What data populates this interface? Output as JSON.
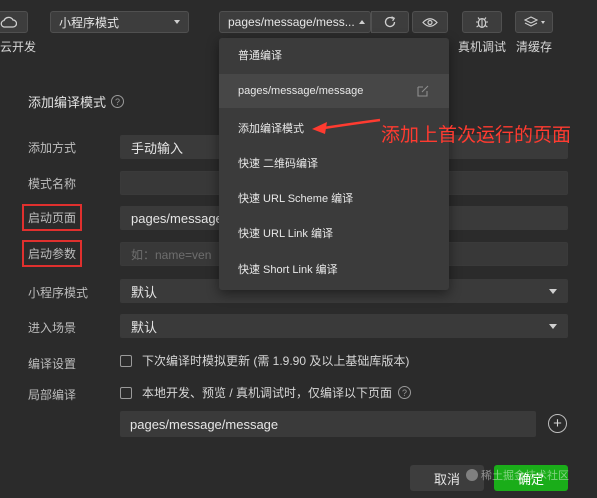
{
  "toolbar": {
    "left_label": "云开发",
    "mode_select": "小程序模式",
    "compile_select": "pages/message/mess...",
    "real_device_label": "真机调试",
    "clear_cache_label": "清缓存"
  },
  "dropdown": {
    "items": [
      {
        "label": "普通编译"
      },
      {
        "label": "pages/message/message"
      },
      {
        "label": "添加编译模式"
      },
      {
        "label": "快速 二维码编译"
      },
      {
        "label": "快速 URL Scheme 编译"
      },
      {
        "label": "快速 URL Link 编译"
      },
      {
        "label": "快速 Short Link 编译"
      }
    ]
  },
  "annotation": {
    "text": "添加上首次运行的页面",
    "color": "#ff3b30"
  },
  "form": {
    "title": "添加编译模式",
    "add_method": {
      "label": "添加方式",
      "value": "手动输入"
    },
    "mode_name": {
      "label": "模式名称",
      "value": ""
    },
    "start_page": {
      "label": "启动页面",
      "value": "pages/message"
    },
    "start_params": {
      "label": "启动参数",
      "placeholder": "如：name=ven"
    },
    "mini_mode": {
      "label": "小程序模式",
      "value": "默认"
    },
    "scene": {
      "label": "进入场景",
      "value": "默认"
    },
    "compile_settings": {
      "label": "编译设置",
      "checkbox_text": "下次编译时模拟更新 (需 1.9.90 及以上基础库版本)"
    },
    "partial_compile": {
      "label": "局部编译",
      "checkbox_text": "本地开发、预览 / 真机调试时，仅编译以下页面"
    },
    "partial_path": "pages/message/message"
  },
  "buttons": {
    "cancel": "取消",
    "ok": "确定"
  },
  "watermark": "稀土掘金技术社区",
  "colors": {
    "background": "#2b2b2b",
    "accent_green": "#1aad19",
    "highlight_red": "#e0302e"
  }
}
